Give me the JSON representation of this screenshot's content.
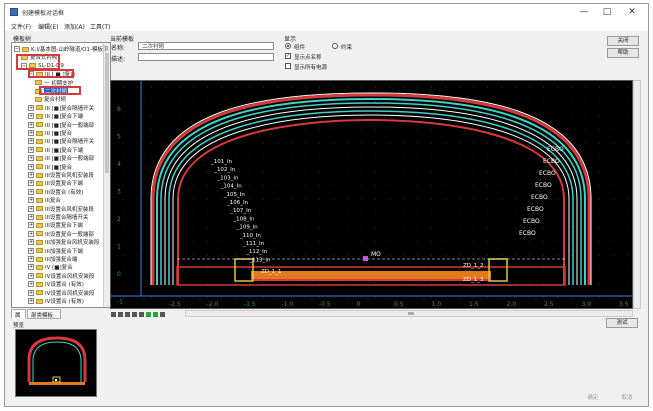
{
  "window": {
    "title": "创建模板对话框",
    "controls": [
      "—",
      "□",
      "✕"
    ]
  },
  "menu": [
    "文件(F)",
    "编辑(E)",
    "添加(A)",
    "工具(T)"
  ],
  "tree": {
    "label": "模板树",
    "items": [
      {
        "text": "K.I/基本图-山岭隧道/O1-模板ㄗ",
        "level": 0,
        "expander": "−"
      },
      {
        "text": "复合式衬砌",
        "level": 1,
        "expander": ""
      },
      {
        "text": "SL-D1-D9",
        "level": 1,
        "expander": "−"
      },
      {
        "text": "III [ ■ ]复合",
        "level": 2,
        "expander": "−"
      },
      {
        "text": "一 初期支护",
        "level": 3,
        "expander": ""
      },
      {
        "text": "二次衬砌",
        "level": 3,
        "expander": "",
        "selected": true
      },
      {
        "text": "复合衬砌",
        "level": 3,
        "expander": ""
      },
      {
        "text": "III [■]复合隔墙开关",
        "level": 2,
        "expander": "+"
      },
      {
        "text": "III [■]复合下端",
        "level": 2,
        "expander": "+"
      },
      {
        "text": "III [■]复合一般端部",
        "level": 2,
        "expander": "+"
      },
      {
        "text": "III [■]复合",
        "level": 2,
        "expander": "+"
      },
      {
        "text": "III [■]复合隔墙开关",
        "level": 2,
        "expander": "+"
      },
      {
        "text": "III [■]复合下端",
        "level": 2,
        "expander": "+"
      },
      {
        "text": "III [■]复合一般端部",
        "level": 2,
        "expander": "+"
      },
      {
        "text": "III [■]复合",
        "level": 2,
        "expander": "+"
      },
      {
        "text": "III设置合风机安装段",
        "level": 2,
        "expander": "+"
      },
      {
        "text": "III设置复合下端",
        "level": 2,
        "expander": "+"
      },
      {
        "text": "III设置合 (有效)",
        "level": 2,
        "expander": "+"
      },
      {
        "text": "III复合",
        "level": 2,
        "expander": "+"
      },
      {
        "text": "III设置合风机安装段",
        "level": 2,
        "expander": "+"
      },
      {
        "text": "III设置合隔墙开关",
        "level": 2,
        "expander": "+"
      },
      {
        "text": "III设置复合下端",
        "level": 2,
        "expander": "+"
      },
      {
        "text": "III设置复合一般端部",
        "level": 2,
        "expander": "+"
      },
      {
        "text": "III加强复合风机安装段",
        "level": 2,
        "expander": "+"
      },
      {
        "text": "III加强复合下端",
        "level": 2,
        "expander": "+"
      },
      {
        "text": "III加强复合端",
        "level": 2,
        "expander": "+"
      },
      {
        "text": "IV [■]复合",
        "level": 2,
        "expander": "+"
      },
      {
        "text": "IV设置合风机安装段",
        "level": 2,
        "expander": "+"
      },
      {
        "text": "IV设置合 (有效)",
        "level": 2,
        "expander": "+"
      },
      {
        "text": "IV设置合风机安装段",
        "level": 2,
        "expander": "+"
      },
      {
        "text": "IV设置合 (有效)",
        "level": 2,
        "expander": "+"
      }
    ]
  },
  "tabs": [
    "属",
    "部类模板"
  ],
  "thumbnail_label": "预览",
  "current_template": {
    "group_label": "当前模板",
    "name_label": "名称:",
    "name_value": "二次衬砌",
    "desc_label": "描述:",
    "desc_value": ""
  },
  "display": {
    "group_label": "显示",
    "radio_component": "组件",
    "radio_constraint": "约束",
    "check_point_names": "显示点名称",
    "check_all_points": "显示所有电源",
    "point_names_checked": true,
    "all_points_checked": false
  },
  "buttons": {
    "close": "关闭",
    "help": "帮助",
    "test": "测试",
    "confirm": "确定",
    "cancel": "取消"
  },
  "canvas": {
    "y_ticks": [
      "6",
      "5",
      "4",
      "3",
      "2",
      "1",
      "0",
      "-1"
    ],
    "x_ticks": [
      "-2.5",
      "-2.0",
      "-1.5",
      "-1.0",
      "-0.5",
      "0",
      "0.5",
      "1.0",
      "1.5",
      "2.0",
      "2.5",
      "3.0",
      "3.5"
    ],
    "left_labels": [
      "_101_In",
      "_102_In",
      "_103_In",
      "_104_In",
      "_105_In",
      "_106_In",
      "_107_In",
      "_108_In",
      "_109_In",
      "_110_In",
      "_111_In",
      "_112_In",
      "_113_In"
    ],
    "right_labels": [
      "ECBO",
      "ECBO",
      "ECBO",
      "ECBO",
      "ECBO",
      "ECBO",
      "ECBO",
      "ECBO"
    ],
    "center_label": "MO",
    "bottom_labels": [
      "ZD_1_1",
      "ZD_1_2",
      "ZD_1_3"
    ],
    "colors": {
      "background": "#000000",
      "outline": "#d43a3a",
      "cyan": "#3fd3c8",
      "white": "#ffffff",
      "orange": "#e27a1c",
      "yellow": "#d8c840",
      "grid_text": "#2aa52a",
      "axis_blue": "#3c82e8"
    }
  }
}
